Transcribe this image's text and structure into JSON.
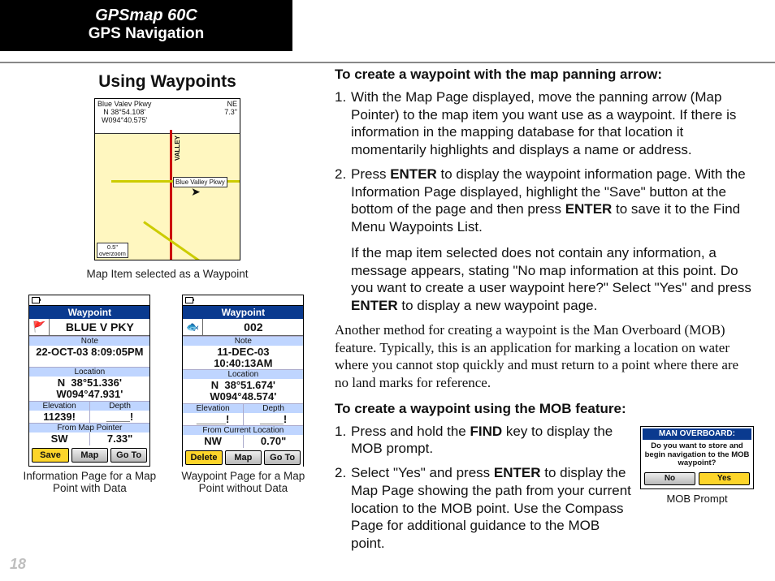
{
  "header": {
    "product": "GPSmap 60C",
    "section": "GPS Navigation"
  },
  "left": {
    "title": "Using Waypoints",
    "map": {
      "banner_left_line1": "Blue Valev Pkwy",
      "banner_left_line2": "N  38°54.108'",
      "banner_left_line3": "W094°40.575'",
      "banner_right_line1": "NE",
      "banner_right_line2": "7.3\"",
      "road_vert_label": "VALLEY",
      "callout": "Blue Valley Pkwy",
      "scale_top": "0.5\"",
      "scale_bot": "overzoom",
      "caption": "Map Item selected as a Waypoint"
    },
    "wpA": {
      "title": "Waypoint",
      "name": "BLUE V PKY",
      "symbol": "🚩",
      "noteLabel": "Note",
      "note": "22-OCT-03 8:09:05PM",
      "locLabel": "Location",
      "loc": "N  38°51.336'\nW094°47.931'",
      "elevLabel": "Elevation",
      "elev": "11239!",
      "depthLabel": "Depth",
      "depth": "____!",
      "fromLabel": "From Map Pointer",
      "fromDir": "SW",
      "fromDist": "7.33\"",
      "btn1": "Save",
      "btn2": "Map",
      "btn3": "Go To",
      "caption": "Information Page for a Map Point with Data"
    },
    "wpB": {
      "title": "Waypoint",
      "name": "002",
      "symbol": "🐟",
      "noteLabel": "Note",
      "note": "11-DEC-03\n10:40:13AM",
      "locLabel": "Location",
      "loc": "N  38°51.674'\nW094°48.574'",
      "elevLabel": "Elevation",
      "elev": "_____!",
      "depthLabel": "Depth",
      "depth": "____!",
      "fromLabel": "From Current Location",
      "fromDir": "NW",
      "fromDist": "0.70\"",
      "btn1": "Delete",
      "btn2": "Map",
      "btn3": "Go To",
      "caption": "Waypoint Page for a Map Point without Data"
    }
  },
  "right": {
    "h1": "To create a waypoint with the map panning arrow:",
    "s1_a": "With the Map Page displayed, move the panning arrow (Map Pointer) to the map item you want use as a waypoint. If there is information in the mapping database for that location it momentarily highlights and displays a name or address.",
    "s2_a": "Press ",
    "s2_b": "ENTER",
    "s2_c": " to display the waypoint information page. With the Information Page displayed, highlight the \"Save\" button at the bottom of the page and then press ",
    "s2_d": "ENTER",
    "s2_e": " to save it to the Find Menu Waypoints List.",
    "s2_ext_a": "If the map item selected does not contain any information, a message appears, stating \"No map information at this point. Do you want to create a user waypoint here?\" Select \"Yes\" and press ",
    "s2_ext_b": "ENTER",
    "s2_ext_c": " to display a new waypoint page.",
    "para": "Another method for creating a waypoint is the Man Overboard (MOB) feature. Typically, this is an application for marking a location on water where you cannot stop quickly and must return to a point where there are no land marks for reference.",
    "h2": "To create a waypoint using the MOB feature:",
    "m1_a": "Press and hold the ",
    "m1_b": "FIND",
    "m1_c": " key to display the MOB prompt.",
    "m2_a": "Select \"Yes\" and press ",
    "m2_b": "ENTER",
    "m2_c": " to display the Map Page showing the path from your current location to the MOB point. Use the Compass Page for additional guidance to the MOB point.",
    "mob": {
      "title": "MAN OVERBOARD:",
      "body": "Do you want to store and begin navigation to the MOB waypoint?",
      "no": "No",
      "yes": "Yes",
      "caption": "MOB Prompt"
    }
  },
  "page": "18"
}
